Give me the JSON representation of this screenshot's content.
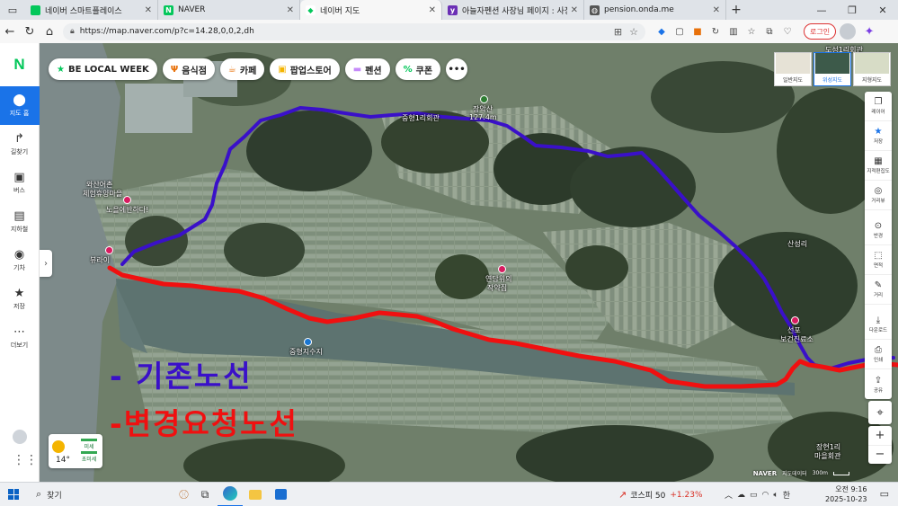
{
  "browser": {
    "tabs": [
      {
        "title": "네이버 스마트플레이스",
        "fav_color": "#03c75a",
        "fav_glyph": "◐"
      },
      {
        "title": "NAVER",
        "fav_color": "#03c75a",
        "fav_glyph": "N"
      },
      {
        "title": "네이버 지도",
        "fav_color": "#03c75a",
        "fav_glyph": "◆"
      },
      {
        "title": "아늘자펜션 사장님 페이지 : 사장님",
        "fav_color": "#6a2fb5",
        "fav_glyph": "y"
      },
      {
        "title": "pension.onda.me",
        "fav_color": "#555555",
        "fav_glyph": "◍"
      }
    ],
    "url": "https://map.naver.com/p?c=14.28,0,0,2,dh",
    "login_label": "로그인"
  },
  "leftnav": {
    "logo": "N",
    "items": [
      {
        "label": "지도 홈",
        "icon": "map-pin-icon",
        "glyph": "⬤"
      },
      {
        "label": "길찾기",
        "icon": "directions-icon",
        "glyph": "↱"
      },
      {
        "label": "버스",
        "icon": "bus-icon",
        "glyph": "▣"
      },
      {
        "label": "지하철",
        "icon": "subway-icon",
        "glyph": "▤"
      },
      {
        "label": "기차",
        "icon": "train-icon",
        "glyph": "◉"
      },
      {
        "label": "저장",
        "icon": "star-icon",
        "glyph": "★"
      },
      {
        "label": "더보기",
        "icon": "more-icon",
        "glyph": "⋯"
      }
    ]
  },
  "chips": [
    {
      "label": "BE LOCAL WEEK",
      "glyph": "★",
      "color": "#03c75a"
    },
    {
      "label": "음식점",
      "glyph": "🍴",
      "color": "#e8710a"
    },
    {
      "label": "카페",
      "glyph": "☕",
      "color": "#e8710a"
    },
    {
      "label": "팝업스토어",
      "glyph": "▣",
      "color": "#f4b400"
    },
    {
      "label": "펜션",
      "glyph": "▬",
      "color": "#c58af9"
    },
    {
      "label": "쿠폰",
      "glyph": "%",
      "color": "#03c75a"
    }
  ],
  "map_types": [
    {
      "label": "일반지도",
      "active": false
    },
    {
      "label": "위성지도",
      "active": true
    },
    {
      "label": "지형지도",
      "active": false
    }
  ],
  "tools": [
    {
      "label": "레이어",
      "glyph": "❐",
      "blue": false
    },
    {
      "label": "저장",
      "glyph": "★",
      "blue": true
    },
    {
      "label": "지적편집도",
      "glyph": "▦",
      "blue": false
    },
    {
      "label": "거리뷰",
      "glyph": "◎",
      "blue": false
    },
    {
      "label": "반경",
      "glyph": "⊙",
      "blue": false
    },
    {
      "label": "면적",
      "glyph": "⬚",
      "blue": false
    },
    {
      "label": "거리",
      "glyph": "✎",
      "blue": false
    },
    {
      "label": "다운로드",
      "glyph": "⤓",
      "blue": false
    },
    {
      "label": "인쇄",
      "glyph": "⎙",
      "blue": false
    },
    {
      "label": "공유",
      "glyph": "⇪",
      "blue": false
    }
  ],
  "weather": {
    "temp": "14°",
    "dust_label": "미세",
    "ultra_label": "초미세"
  },
  "map_labels": {
    "mountain": "장악산",
    "elevation": "127.4m",
    "village1": "중형1리회관",
    "village2": "도성1리회관",
    "village3a": "와산어촌",
    "village3b": "체험휴양마을",
    "poi1": "노을에반하다!",
    "poi2": "뷰라이",
    "poi3": "연담위의",
    "poi4": "작약집",
    "lake": "중형지수지",
    "village4": "산성리",
    "village5a": "장현1리",
    "village5b": "마을회관",
    "area1": "선포",
    "area2": "보건진료소",
    "scale": "300m",
    "footer_logo": "NAVER",
    "footer_text": "지도데이터"
  },
  "annotations": {
    "blue_label": "- 기존노선",
    "red_label": "-변경요청노선",
    "blue_color": "#3a10c9",
    "red_color": "#f01010"
  },
  "taskbar": {
    "search": "찾기",
    "stock_name": "코스피 50",
    "stock_change": "+1.23%",
    "ime": "한",
    "time": "오전 9:16",
    "date": "2025-10-23"
  }
}
